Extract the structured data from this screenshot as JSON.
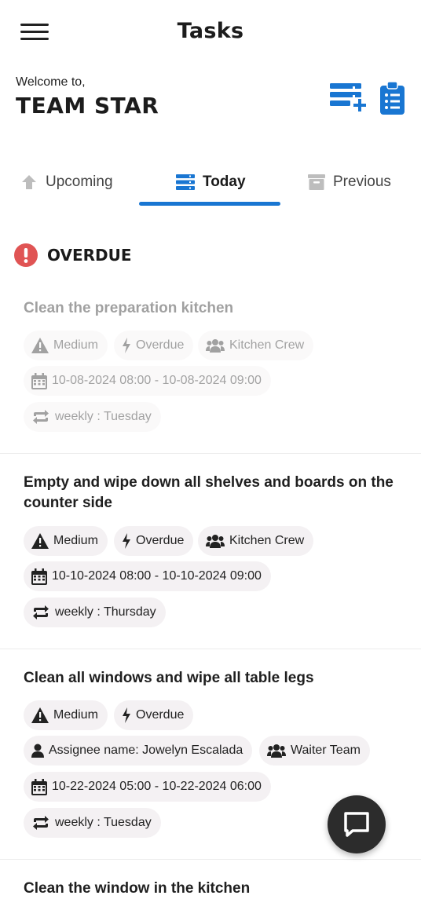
{
  "header": {
    "title": "Tasks",
    "menu_icon": "hamburger-menu-icon"
  },
  "welcome": {
    "label": "Welcome to,",
    "team": "TEAM STAR"
  },
  "actions": {
    "add_task_icon": "add-list-icon",
    "checklist_icon": "clipboard-list-icon",
    "accent": "#1976d2"
  },
  "tabs": [
    {
      "label": "Upcoming",
      "icon": "arrow-up-icon"
    },
    {
      "label": "Today",
      "icon": "list-bars-icon",
      "active": true
    },
    {
      "label": "Previous",
      "icon": "archive-icon"
    }
  ],
  "section": {
    "title": "OVERDUE",
    "icon": "exclamation-circle-icon",
    "icon_color": "#e05454"
  },
  "tasks": [
    {
      "title": "Clean the preparation kitchen",
      "priority": "Medium",
      "status": "Overdue",
      "team": "Kitchen Crew",
      "datetime": "10-08-2024 08:00 - 10-08-2024 09:00",
      "recurrence": "weekly : Tuesday"
    },
    {
      "title": "Empty and wipe down all shelves and boards on the counter side",
      "priority": "Medium",
      "status": "Overdue",
      "team": "Kitchen Crew",
      "datetime": "10-10-2024 08:00 - 10-10-2024 09:00",
      "recurrence": "weekly : Thursday"
    },
    {
      "title": "Clean all windows and wipe all table legs",
      "priority": "Medium",
      "status": "Overdue",
      "assignee": "Assignee name: Jowelyn Escalada",
      "team": "Waiter Team",
      "datetime": "10-22-2024 05:00 - 10-22-2024 06:00",
      "recurrence": "weekly : Tuesday"
    },
    {
      "title": "Clean the window in the kitchen"
    }
  ],
  "fab": {
    "icon": "chat-bubble-icon"
  }
}
